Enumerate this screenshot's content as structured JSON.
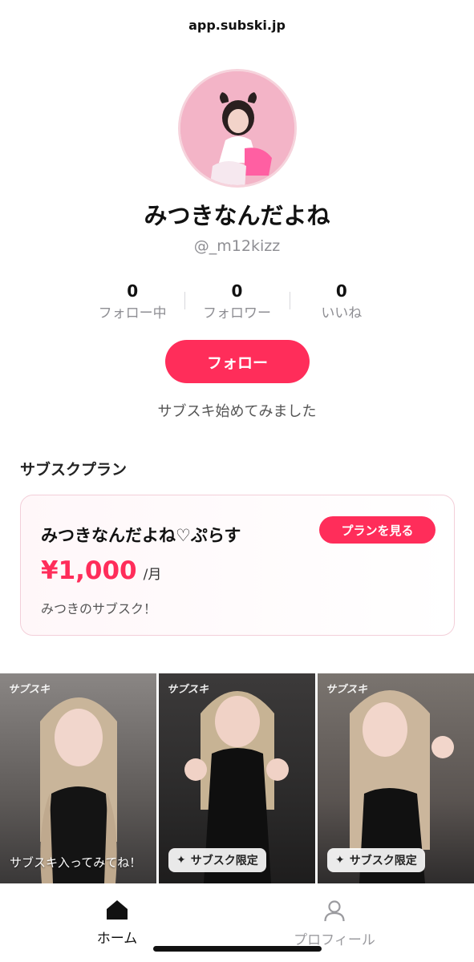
{
  "browser": {
    "url": "app.subski.jp"
  },
  "profile": {
    "display_name": "みつきなんだよね",
    "handle": "@_m12kizz",
    "bio": "サブスキ始めてみました",
    "follow_button_label": "フォロー"
  },
  "stats": [
    {
      "value": "0",
      "label": "フォロー中"
    },
    {
      "value": "0",
      "label": "フォロワー"
    },
    {
      "value": "0",
      "label": "いいね"
    }
  ],
  "plans_section": {
    "title": "サブスクプラン",
    "plan": {
      "name": "みつきなんだよね♡ぷらす",
      "view_button_label": "プランを見る",
      "price": "¥1,000",
      "price_unit": "/月",
      "description": "みつきのサブスク！"
    }
  },
  "posts": [
    {
      "watermark": "サブスキ",
      "caption": "サブスキ入ってみてね！",
      "badge": null
    },
    {
      "watermark": "サブスキ",
      "caption": null,
      "badge": "サブスク限定"
    },
    {
      "watermark": "サブスキ",
      "caption": null,
      "badge": "サブスク限定"
    }
  ],
  "tabbar": {
    "items": [
      {
        "label": "ホーム",
        "icon": "home-icon",
        "active": true
      },
      {
        "label": "プロフィール",
        "icon": "person-icon",
        "active": false
      }
    ]
  },
  "colors": {
    "accent": "#ff2d5a",
    "muted_text": "#8e8e93"
  }
}
